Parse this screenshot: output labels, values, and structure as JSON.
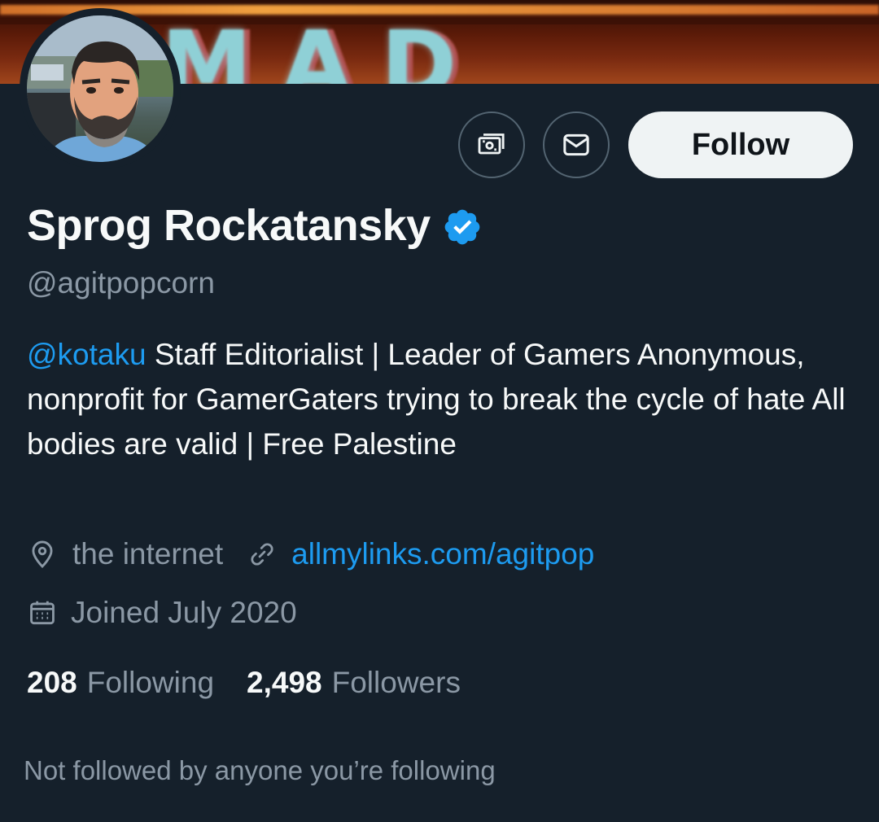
{
  "banner": {
    "text": "MAD"
  },
  "actions": {
    "subscribe_icon": "money-icon",
    "message_icon": "mail-icon",
    "follow_label": "Follow"
  },
  "profile": {
    "name": "Sprog Rockatansky",
    "verified": true,
    "handle": "@agitpopcorn",
    "bio_mention": "@kotaku",
    "bio_text": " Staff Editorialist | Leader of Gamers Anonymous, nonprofit for GamerGaters trying to break the cycle of hate  All bodies are valid | Free Palestine",
    "location": "the internet",
    "website": "allmylinks.com/agitpop",
    "joined": "Joined July 2020"
  },
  "stats": {
    "following_count": "208",
    "following_label": "Following",
    "followers_count": "2,498",
    "followers_label": "Followers"
  },
  "social_context": "Not followed by anyone you’re following",
  "colors": {
    "background": "#15202b",
    "accent": "#1d9bf0",
    "muted_text": "#8b98a5",
    "primary_text": "#f7f9f9",
    "follow_bg": "#eff3f4"
  }
}
